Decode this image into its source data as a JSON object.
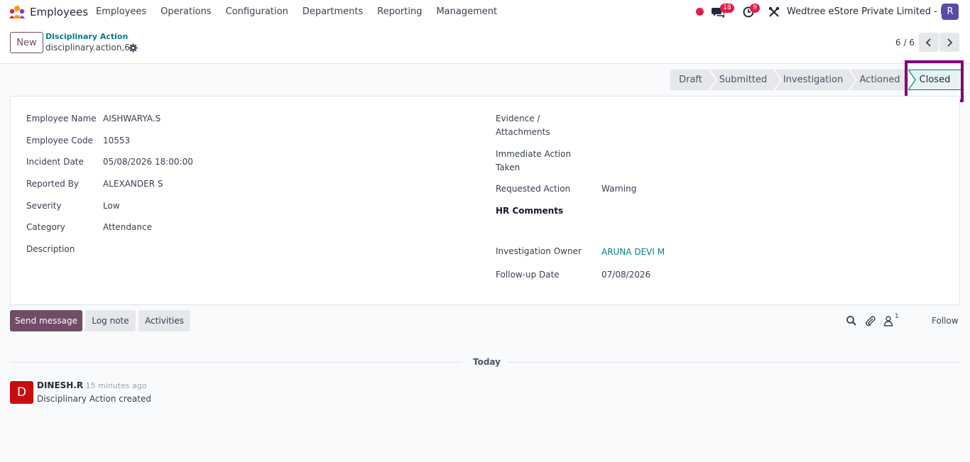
{
  "navbar": {
    "app_name": "Employees",
    "menu": [
      "Employees",
      "Operations",
      "Configuration",
      "Departments",
      "Reporting",
      "Management"
    ],
    "messages_count": "18",
    "activities_count": "9",
    "company": "Wedtree eStore Private Limited - HO",
    "user_initial": "R",
    "icons": [
      "app-logo-icon",
      "status-dot-icon",
      "chat-icon",
      "clock-icon",
      "tools-icon"
    ]
  },
  "control": {
    "new_label": "New",
    "breadcrumb_parent": "Disciplinary Action",
    "record_name": "disciplinary.action,6",
    "pager": "6 / 6"
  },
  "statusbar": {
    "stages": [
      "Draft",
      "Submitted",
      "Investigation",
      "Actioned",
      "Closed"
    ],
    "active": "Closed",
    "active_color": "#017e84",
    "highlight_color": "#800080"
  },
  "form": {
    "left": [
      {
        "label": "Employee Name",
        "value": "AISHWARYA.S"
      },
      {
        "label": "Employee Code",
        "value": "10553"
      },
      {
        "label": "Incident Date",
        "value": "05/08/2026 18:00:00"
      },
      {
        "label": "Reported By",
        "value": "ALEXANDER S"
      },
      {
        "label": "Severity",
        "value": "Low"
      },
      {
        "label": "Category",
        "value": "Attendance"
      },
      {
        "label": "Description",
        "value": ""
      }
    ],
    "right": {
      "evidence_label_1": "Evidence /",
      "evidence_label_2": "Attachments",
      "immediate_label_1": "Immediate Action",
      "immediate_label_2": "Taken",
      "requested_label": "Requested Action",
      "requested_value": "Warning",
      "hr_comments_label": "HR Comments",
      "owner_label": "Investigation Owner",
      "owner_value": "ARUNA DEVI M",
      "followup_label": "Follow-up Date",
      "followup_value": "07/08/2026"
    }
  },
  "chatter": {
    "send_message": "Send message",
    "log_note": "Log note",
    "activities": "Activities",
    "followers_count": "1",
    "follow": "Follow",
    "date_separator": "Today",
    "message": {
      "avatar_initial": "D",
      "author": "DINESH.R",
      "time": "- 15 minutes ago",
      "body": "Disciplinary Action created"
    },
    "accent_color": "#714b67"
  }
}
